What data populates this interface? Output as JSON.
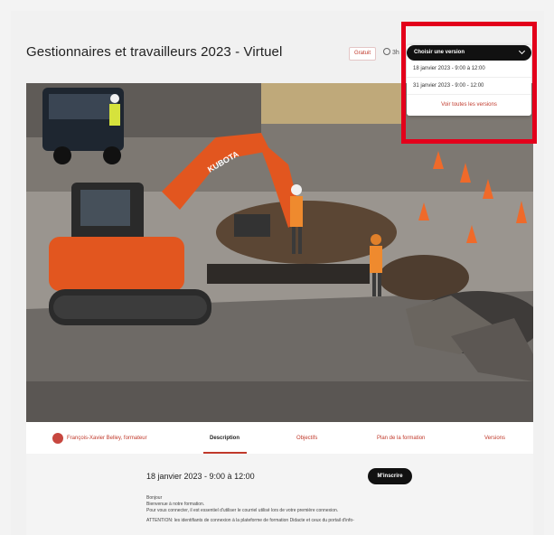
{
  "page": {
    "title": "Gestionnaires et travailleurs 2023 - Virtuel",
    "badge": "Gratuit",
    "duration": "3h"
  },
  "version_dropdown": {
    "label": "Choisir une version",
    "options": [
      "18 janvier 2023 - 9:00 à 12:00",
      "31 janvier 2023 - 9:00 - 12:00"
    ],
    "view_all": "Voir toutes les versions"
  },
  "hero": {
    "excavator_brand": "KUBOTA"
  },
  "tabs": {
    "trainer": "François-Xavier Belley, formateur",
    "items": [
      "Description",
      "Objectifs",
      "Plan de la formation",
      "Versions"
    ],
    "active": "Description"
  },
  "session": {
    "date": "18 janvier 2023 - 9:00 à 12:00",
    "signup_label": "M'inscrire",
    "description": [
      "Bonjour",
      "Bienvenue à notre formation.",
      "Pour vous connecter, il est essentiel d'utiliser le courriel utilisé lors de votre première connexion.",
      "ATTENTION: les identifiants de connexion à la plateforme de formation Didacte et ceux du portail d'info-"
    ]
  },
  "colors": {
    "accent": "#c0392b",
    "highlight": "#e3001b",
    "dark_button": "#111111"
  }
}
